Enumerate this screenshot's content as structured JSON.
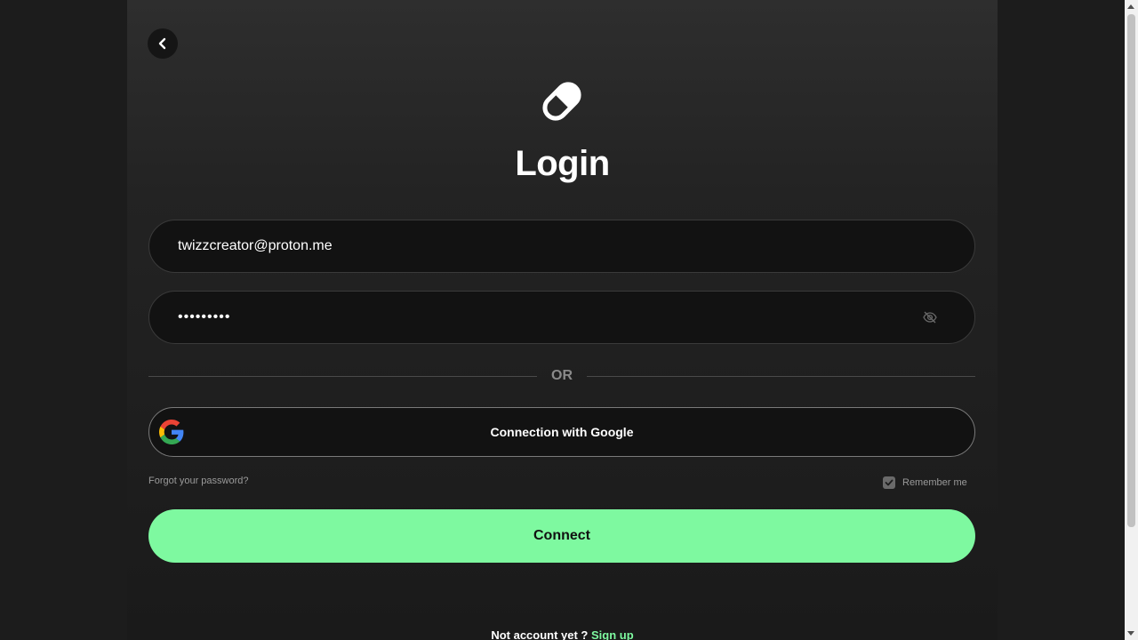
{
  "page": {
    "title": "Login",
    "back_button": "chevron-left-icon",
    "logo_icon": "pill-icon"
  },
  "form": {
    "email_value": "twizzcreator@proton.me",
    "password_value": "•••••••••",
    "password_toggle_icon": "eye-off-icon",
    "divider_text": "OR",
    "google_label": "Connection with Google",
    "forgot_label": "Forgot your password?",
    "remember_label": "Remember me",
    "remember_checked": true,
    "connect_label": "Connect"
  },
  "footer": {
    "prompt": "Not account yet ?",
    "signup_label": "Sign up"
  },
  "colors": {
    "accent": "#7ef9a0",
    "background": "#1c1c1c",
    "panel": "#232323"
  }
}
